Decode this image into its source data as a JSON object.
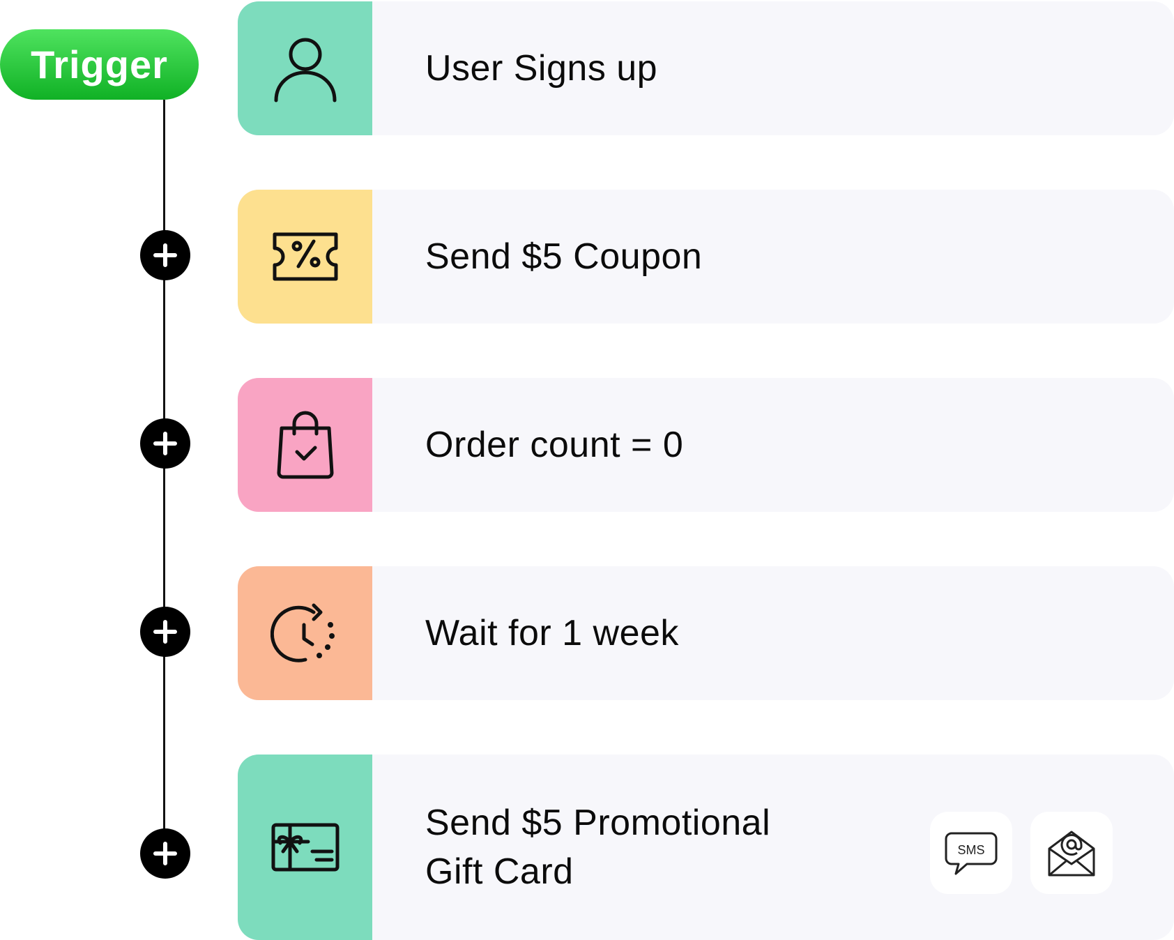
{
  "trigger": {
    "label": "Trigger"
  },
  "steps": [
    {
      "label": "User Signs up",
      "icon": "user-icon",
      "color": "#7ddcbd"
    },
    {
      "label": "Send $5 Coupon",
      "icon": "coupon-icon",
      "color": "#fde08f"
    },
    {
      "label": "Order count = 0",
      "icon": "shopping-bag-check-icon",
      "color": "#f9a4c3"
    },
    {
      "label": "Wait for 1 week",
      "icon": "clock-wait-icon",
      "color": "#fbb895"
    },
    {
      "label": "Send $5 Promotional\nGift Card",
      "icon": "gift-card-icon",
      "color": "#7ddcbd"
    }
  ],
  "channels": [
    {
      "label": "SMS",
      "icon": "sms-icon"
    },
    {
      "icon": "email-icon"
    }
  ],
  "add_buttons": {
    "icon": "plus-icon",
    "count": 4
  },
  "colors": {
    "trigger_start": "#4fe35f",
    "trigger_end": "#10b125",
    "card_bg": "#f7f7fb"
  }
}
